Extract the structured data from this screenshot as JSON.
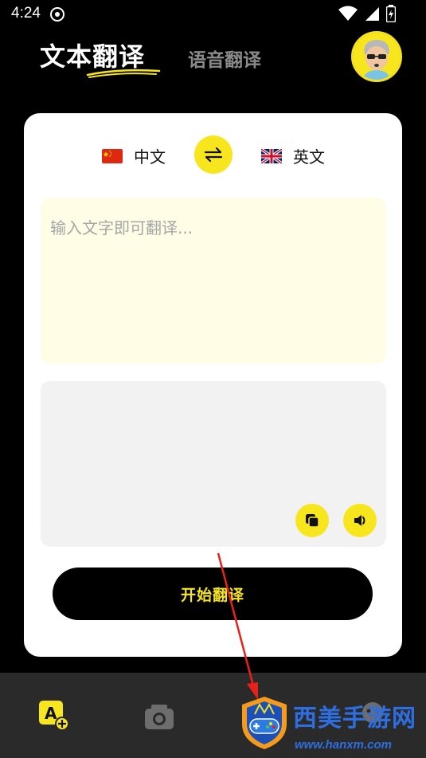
{
  "status_bar": {
    "time": "4:24"
  },
  "header": {
    "tab_text": "文本翻译",
    "tab_voice": "语音翻译"
  },
  "languages": {
    "source": "中文",
    "target": "英文",
    "source_flag": "china-flag",
    "target_flag": "uk-flag"
  },
  "input": {
    "placeholder": "输入文字即可翻译...",
    "value": ""
  },
  "output": {
    "text": ""
  },
  "actions": {
    "translate_label": "开始翻译"
  },
  "bottom_nav": {
    "items": [
      {
        "icon": "text-translate-icon",
        "active": true
      },
      {
        "icon": "camera-icon",
        "active": false
      },
      {
        "icon": "document-icon",
        "active": false
      },
      {
        "icon": "profile-icon",
        "active": false
      }
    ]
  },
  "watermark": {
    "title": "西美手游网",
    "url": "www.hanxm.com"
  },
  "colors": {
    "accent": "#f7e51e",
    "background": "#000000",
    "card": "#ffffff",
    "input_bg": "#fffde6",
    "output_bg": "#f2f2f2",
    "nav_bg": "#2a2a2a"
  }
}
